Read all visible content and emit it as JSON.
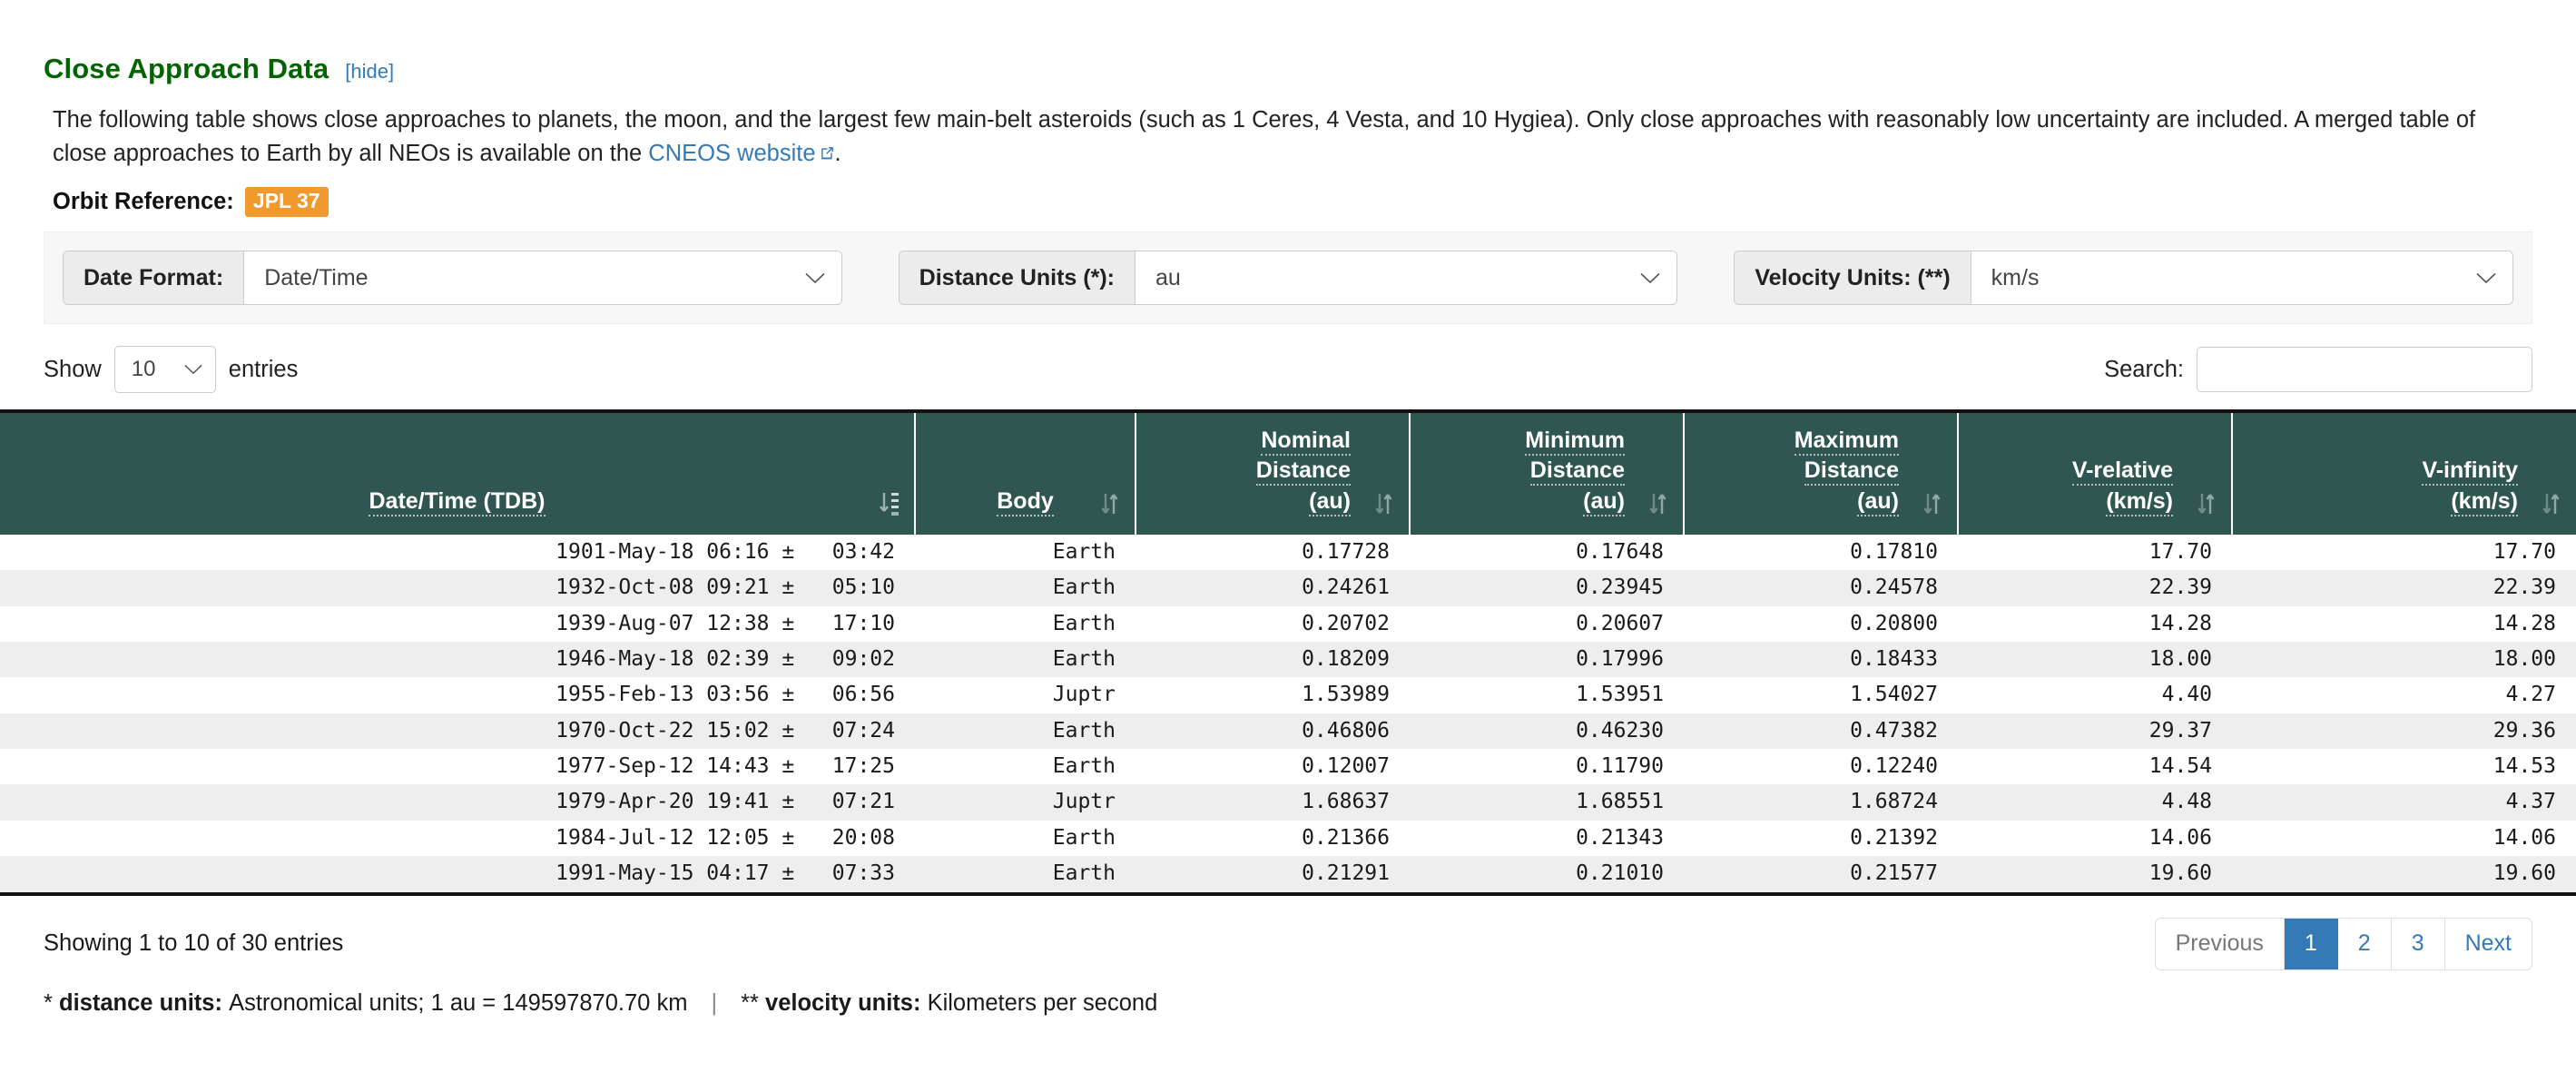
{
  "section": {
    "title": "Close Approach Data",
    "hide_link": "[hide]"
  },
  "description": {
    "part1": "The following table shows close approaches to planets, the moon, and the largest few main-belt asteroids (such as 1 Ceres, 4 Vesta, and 10 Hygiea). Only close approaches with reasonably low uncertainty are included. A merged table of close approaches to Earth by all NEOs is available on the ",
    "link_text": "CNEOS website",
    "part2": "."
  },
  "orbit_reference": {
    "label": "Orbit Reference:",
    "value": "JPL 37"
  },
  "controls": [
    {
      "label": "Date Format:",
      "value": "Date/Time"
    },
    {
      "label": "Distance Units (*):",
      "value": "au"
    },
    {
      "label": "Velocity Units: (**)",
      "value": "km/s"
    }
  ],
  "table_tools": {
    "show_label": "Show",
    "entries_label": "entries",
    "page_length": "10",
    "search_label": "Search:",
    "search_value": "",
    "search_placeholder": ""
  },
  "table": {
    "columns": [
      {
        "key": "date",
        "lines": [
          "Date/Time (TDB)"
        ],
        "align": "center",
        "sorted": "asc"
      },
      {
        "key": "body",
        "lines": [
          "Body"
        ],
        "align": "center",
        "sorted": "none"
      },
      {
        "key": "nominal",
        "lines": [
          "Nominal",
          "Distance",
          "(au)"
        ],
        "align": "right",
        "sorted": "none"
      },
      {
        "key": "minimum",
        "lines": [
          "Minimum",
          "Distance",
          "(au)"
        ],
        "align": "right",
        "sorted": "none"
      },
      {
        "key": "maximum",
        "lines": [
          "Maximum",
          "Distance",
          "(au)"
        ],
        "align": "right",
        "sorted": "none"
      },
      {
        "key": "vrel",
        "lines": [
          "V-relative",
          "(km/s)"
        ],
        "align": "right",
        "sorted": "none"
      },
      {
        "key": "vinf",
        "lines": [
          "V-infinity",
          "(km/s)"
        ],
        "align": "right",
        "sorted": "none"
      }
    ],
    "rows": [
      [
        "1901-May-18 06:16 ±   03:42",
        "Earth",
        "0.17728",
        "0.17648",
        "0.17810",
        "17.70",
        "17.70"
      ],
      [
        "1932-Oct-08 09:21 ±   05:10",
        "Earth",
        "0.24261",
        "0.23945",
        "0.24578",
        "22.39",
        "22.39"
      ],
      [
        "1939-Aug-07 12:38 ±   17:10",
        "Earth",
        "0.20702",
        "0.20607",
        "0.20800",
        "14.28",
        "14.28"
      ],
      [
        "1946-May-18 02:39 ±   09:02",
        "Earth",
        "0.18209",
        "0.17996",
        "0.18433",
        "18.00",
        "18.00"
      ],
      [
        "1955-Feb-13 03:56 ±   06:56",
        "Juptr",
        "1.53989",
        "1.53951",
        "1.54027",
        "4.40",
        "4.27"
      ],
      [
        "1970-Oct-22 15:02 ±   07:24",
        "Earth",
        "0.46806",
        "0.46230",
        "0.47382",
        "29.37",
        "29.36"
      ],
      [
        "1977-Sep-12 14:43 ±   17:25",
        "Earth",
        "0.12007",
        "0.11790",
        "0.12240",
        "14.54",
        "14.53"
      ],
      [
        "1979-Apr-20 19:41 ±   07:21",
        "Juptr",
        "1.68637",
        "1.68551",
        "1.68724",
        "4.48",
        "4.37"
      ],
      [
        "1984-Jul-12 12:05 ±   20:08",
        "Earth",
        "0.21366",
        "0.21343",
        "0.21392",
        "14.06",
        "14.06"
      ],
      [
        "1991-May-15 04:17 ±   07:33",
        "Earth",
        "0.21291",
        "0.21010",
        "0.21577",
        "19.60",
        "19.60"
      ]
    ]
  },
  "footer": {
    "info": "Showing 1 to 10 of 30 entries",
    "pagination": [
      {
        "label": "Previous",
        "state": "disabled"
      },
      {
        "label": "1",
        "state": "active"
      },
      {
        "label": "2",
        "state": "normal"
      },
      {
        "label": "3",
        "state": "normal"
      },
      {
        "label": "Next",
        "state": "normal"
      }
    ]
  },
  "notes": {
    "distance_marker": "*",
    "distance_label": "distance units:",
    "distance_text": "Astronomical units; 1 au = 149597870.70 km",
    "separator": "|",
    "velocity_marker": "**",
    "velocity_label": "velocity units:",
    "velocity_text": "Kilometers per second"
  },
  "colors": {
    "section_title": "#006400",
    "link": "#337ab7",
    "badge": "#f0992e",
    "table_header_bg": "#2f5650",
    "row_stripe": "#eeeeee",
    "pager_active": "#337ab7"
  }
}
